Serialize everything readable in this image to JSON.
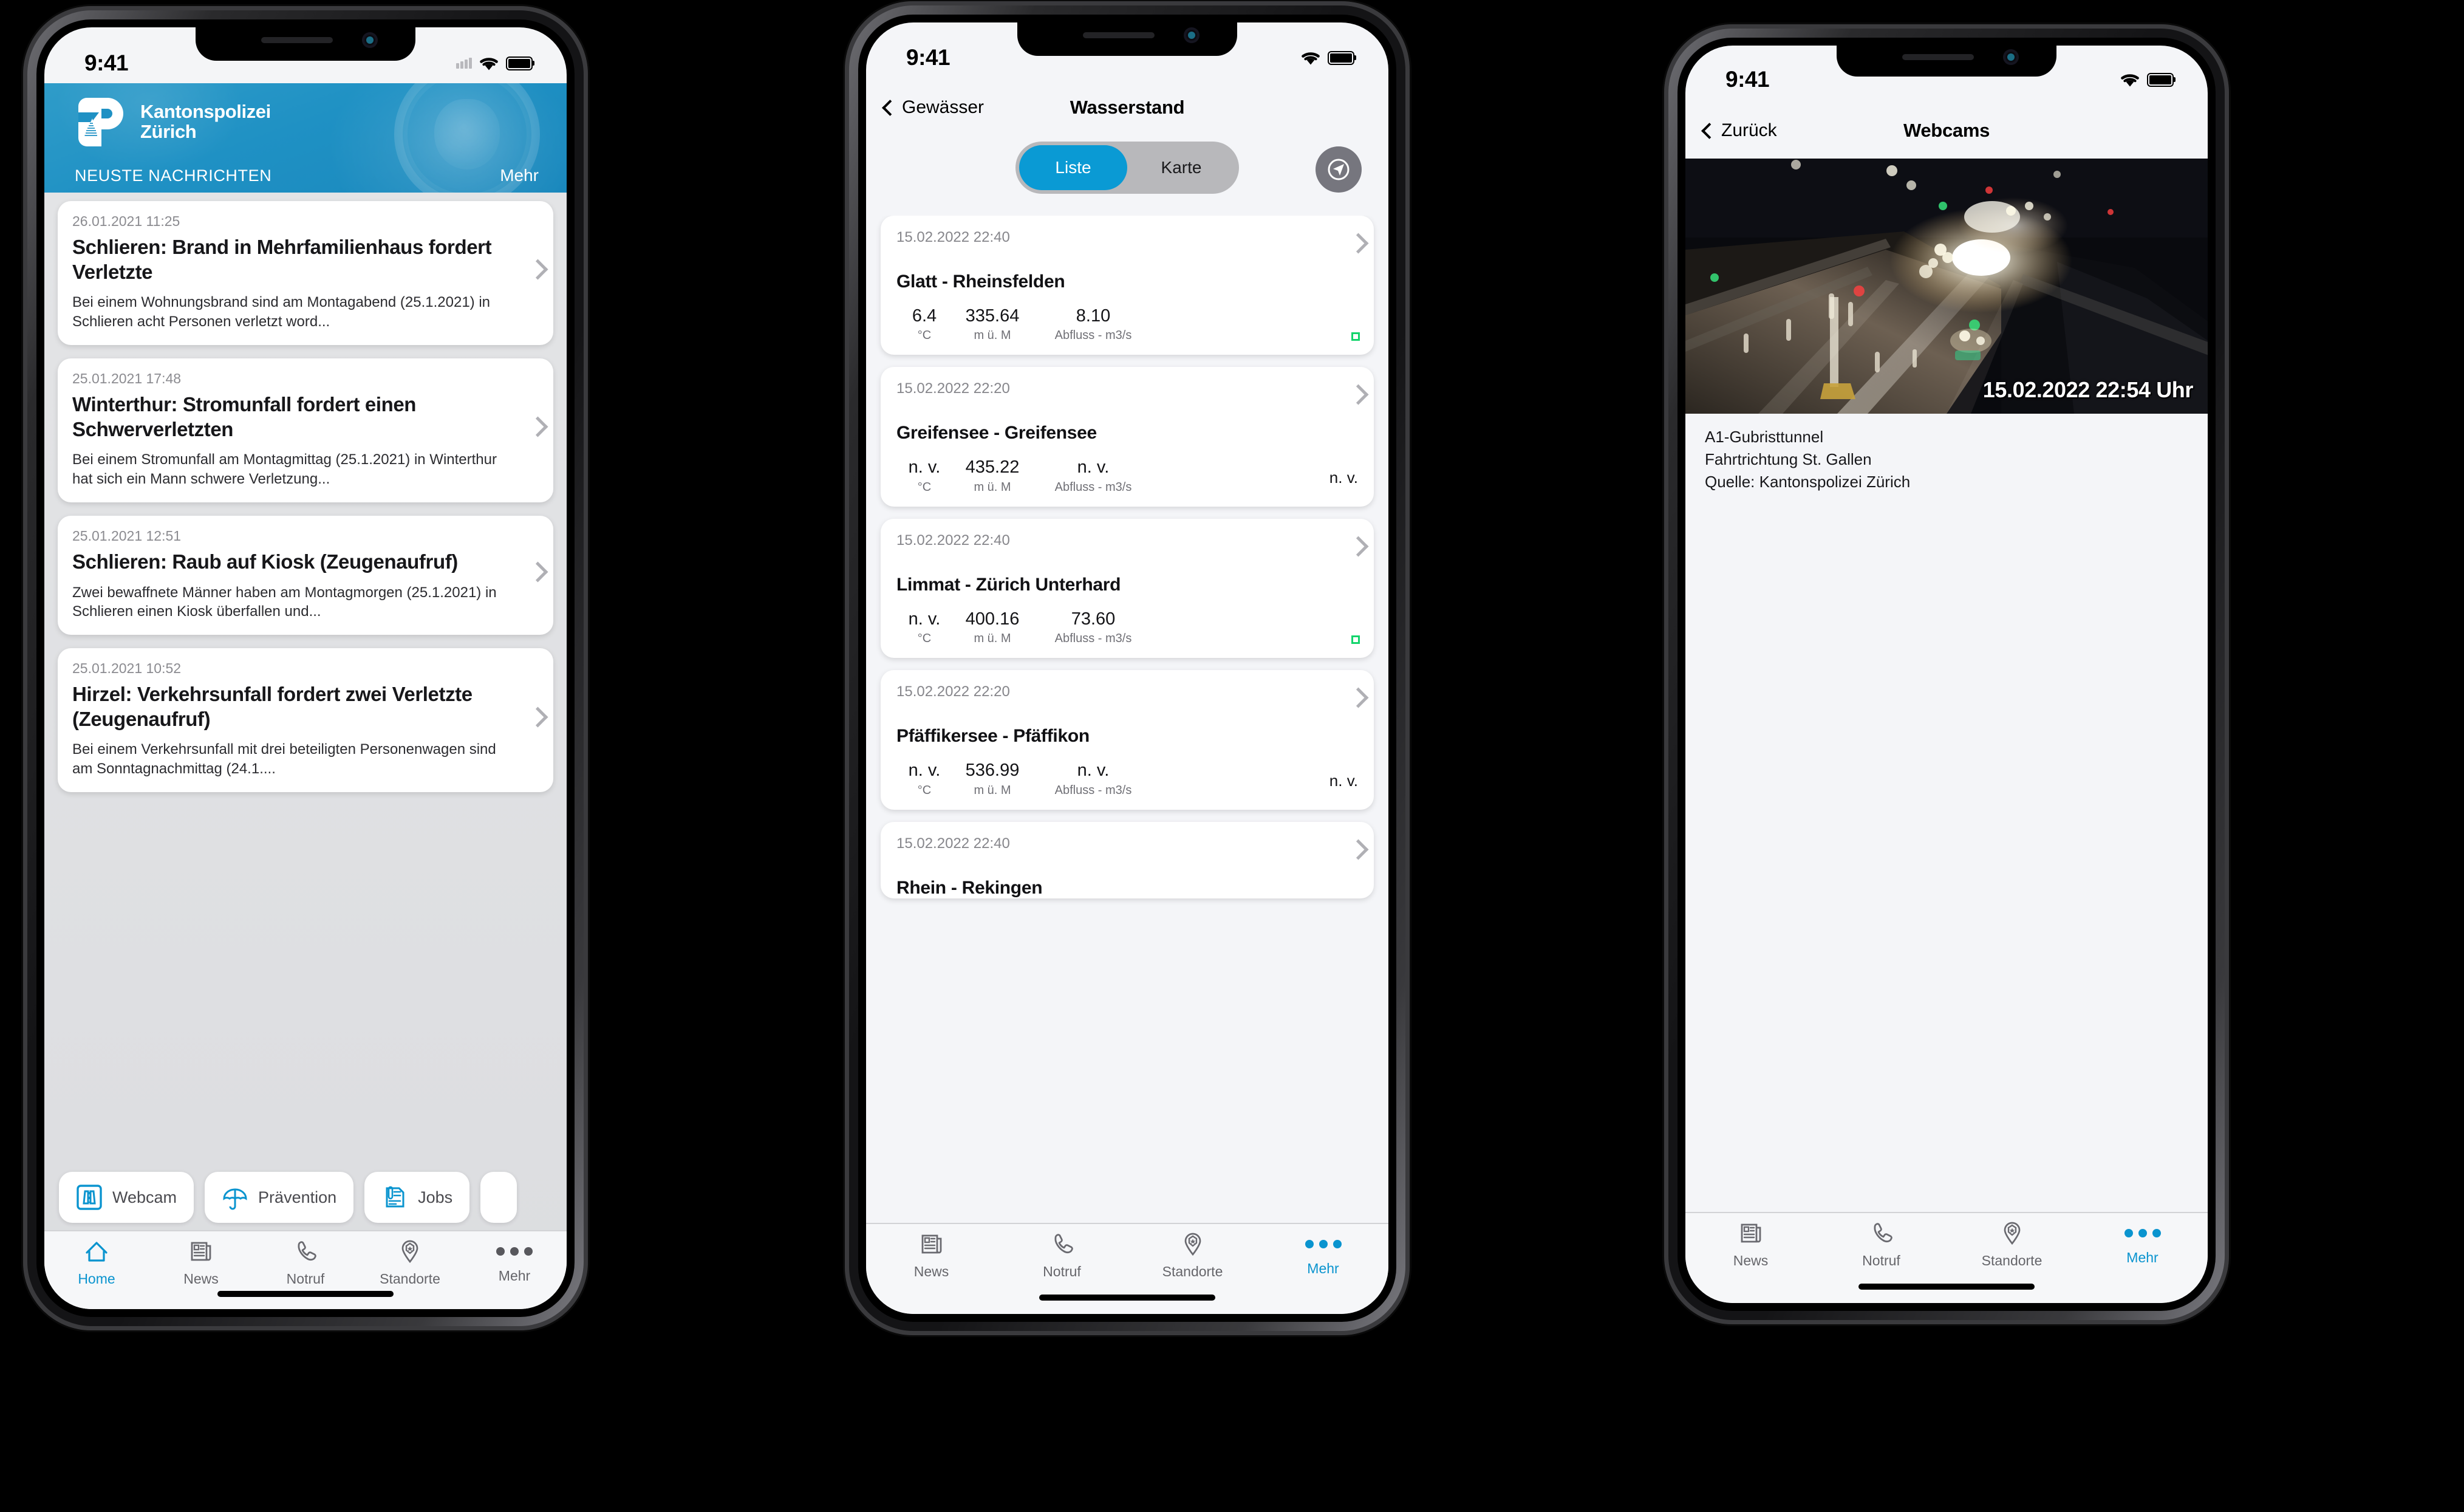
{
  "phone1": {
    "status_bar": {
      "time": "9:41"
    },
    "header": {
      "logo_line1": "Kantonspolizei",
      "logo_line2": "Zürich",
      "section_label": "NEUSTE NACHRICHTEN",
      "more_label": "Mehr",
      "bg_color": "#1f91c4"
    },
    "news": [
      {
        "date": "26.01.2021 11:25",
        "title": "Schlieren: Brand in Mehrfamilienhaus fordert Verletzte",
        "text": "Bei einem Wohnungsbrand sind am Montagabend (25.1.2021) in Schlieren acht Personen verletzt word..."
      },
      {
        "date": "25.01.2021 17:48",
        "title": "Winterthur: Stromunfall fordert einen Schwerverletzten",
        "text": "Bei einem Stromunfall am Montagmittag (25.1.2021) in Winterthur hat sich ein Mann schwere Verletzung..."
      },
      {
        "date": "25.01.2021 12:51",
        "title": "Schlieren: Raub auf Kiosk (Zeugenaufruf)",
        "text": "Zwei bewaffnete Männer haben am Montagmorgen (25.1.2021) in Schlieren einen Kiosk überfallen und..."
      },
      {
        "date": "25.01.2021 10:52",
        "title": "Hirzel: Verkehrsunfall fordert zwei Verletzte (Zeugenaufruf)",
        "text": "Bei einem Verkehrsunfall mit drei beteiligten Personenwagen sind am Sonntagnachmittag (24.1...."
      }
    ],
    "chips": [
      {
        "label": "Webcam",
        "icon": "motorway-icon"
      },
      {
        "label": "Prävention",
        "icon": "umbrella-icon"
      },
      {
        "label": "Jobs",
        "icon": "document-pen-icon"
      }
    ],
    "tabs": [
      {
        "label": "Home",
        "icon": "home-icon",
        "active": true
      },
      {
        "label": "News",
        "icon": "newspaper-icon",
        "active": false
      },
      {
        "label": "Notruf",
        "icon": "phone-icon",
        "active": false
      },
      {
        "label": "Standorte",
        "icon": "map-pin-star-icon",
        "active": false
      },
      {
        "label": "Mehr",
        "icon": "ellipsis-icon",
        "active": false
      }
    ]
  },
  "phone2": {
    "status_bar": {
      "time": "9:41"
    },
    "navbar": {
      "back_label": "Gewässer",
      "title": "Wasserstand"
    },
    "segmented": {
      "options": [
        "Liste",
        "Karte"
      ],
      "selected": "Liste"
    },
    "locate_button": {
      "icon": "navigation-arrow-icon"
    },
    "units": {
      "temp": "°C",
      "level": "m ü. M",
      "flow": "Abfluss - m3/s"
    },
    "stations": [
      {
        "date": "15.02.2022 22:40",
        "name": "Glatt - Rheinsfelden",
        "temp": "6.4",
        "level": "335.64",
        "flow": "8.10",
        "status": "green",
        "status_text": ""
      },
      {
        "date": "15.02.2022 22:20",
        "name": "Greifensee - Greifensee",
        "temp": "n. v.",
        "level": "435.22",
        "flow": "n. v.",
        "status": "text",
        "status_text": "n. v."
      },
      {
        "date": "15.02.2022 22:40",
        "name": "Limmat - Zürich Unterhard",
        "temp": "n. v.",
        "level": "400.16",
        "flow": "73.60",
        "status": "green",
        "status_text": ""
      },
      {
        "date": "15.02.2022 22:20",
        "name": "Pfäffikersee - Pfäffikon",
        "temp": "n. v.",
        "level": "536.99",
        "flow": "n. v.",
        "status": "text",
        "status_text": "n. v."
      },
      {
        "date": "15.02.2022 22:40",
        "name": "Rhein - Rekingen",
        "temp": "",
        "level": "",
        "flow": "",
        "status": "none",
        "status_text": ""
      }
    ],
    "tabs": [
      {
        "label": "News",
        "icon": "newspaper-icon",
        "active": false
      },
      {
        "label": "Notruf",
        "icon": "phone-icon",
        "active": false
      },
      {
        "label": "Standorte",
        "icon": "map-pin-star-icon",
        "active": false
      },
      {
        "label": "Mehr",
        "icon": "ellipsis-icon",
        "active": true
      }
    ]
  },
  "phone3": {
    "status_bar": {
      "time": "9:41"
    },
    "navbar": {
      "back_label": "Zurück",
      "title": "Webcams"
    },
    "webcam": {
      "timestamp": "15.02.2022 22:54 Uhr",
      "caption_line1": "A1-Gubristtunnel",
      "caption_line2": "Fahrtrichtung St. Gallen",
      "caption_line3": "Quelle: Kantonspolizei Zürich"
    },
    "tabs": [
      {
        "label": "News",
        "icon": "newspaper-icon",
        "active": false
      },
      {
        "label": "Notruf",
        "icon": "phone-icon",
        "active": false
      },
      {
        "label": "Standorte",
        "icon": "map-pin-star-icon",
        "active": false
      },
      {
        "label": "Mehr",
        "icon": "ellipsis-icon",
        "active": true
      }
    ]
  },
  "colors": {
    "accent_blue": "#0a94cf",
    "header_blue": "#1f91c4",
    "status_green": "#14d46c"
  }
}
